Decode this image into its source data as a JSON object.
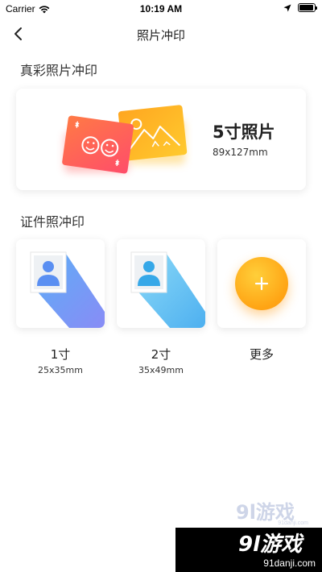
{
  "status_bar": {
    "carrier": "Carrier",
    "time": "10:19 AM"
  },
  "nav": {
    "title": "照片冲印",
    "back_icon": "chevron-left-icon"
  },
  "sections": {
    "color_photo_title": "真彩照片冲印",
    "id_photo_title": "证件照冲印"
  },
  "color_photo": {
    "name": "5寸照片",
    "size": "89x127mm"
  },
  "id_photos": [
    {
      "label": "1寸",
      "size": "25x35mm",
      "accent": "#6f86f5"
    },
    {
      "label": "2寸",
      "size": "35x49mm",
      "accent": "#47b6f2"
    },
    {
      "label": "更多",
      "size": "",
      "accent": "#ffa414"
    }
  ],
  "watermark": {
    "text": "9l游戏",
    "url": "91danji.com"
  }
}
